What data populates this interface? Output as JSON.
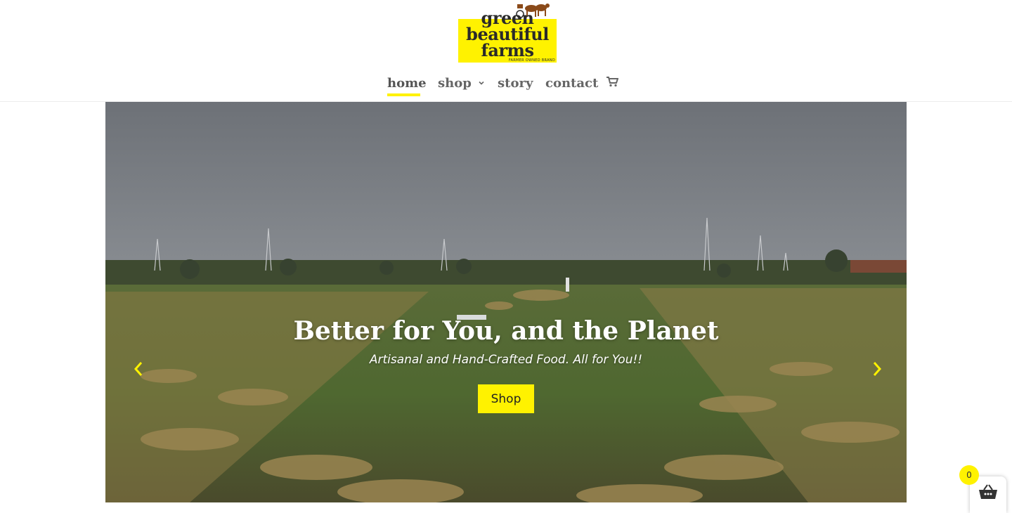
{
  "brand": {
    "logo_line1": "green",
    "logo_line2": "beautiful",
    "logo_line3": "farms",
    "tagline": "FARMER OWNED BRAND",
    "accent_color": "#fff200"
  },
  "nav": {
    "items": [
      {
        "label": "home",
        "active": true
      },
      {
        "label": "shop",
        "has_dropdown": true
      },
      {
        "label": "story"
      },
      {
        "label": "contact"
      }
    ],
    "cart_icon": "shopping-cart-icon"
  },
  "hero": {
    "title": "Better for You, and the Planet",
    "subtitle": "Artisanal and Hand-Crafted Food. All for You!!",
    "button_label": "Shop",
    "prev_icon": "chevron-left-icon",
    "next_icon": "chevron-right-icon"
  },
  "mini_cart": {
    "count": "0",
    "icon": "basket-icon"
  }
}
